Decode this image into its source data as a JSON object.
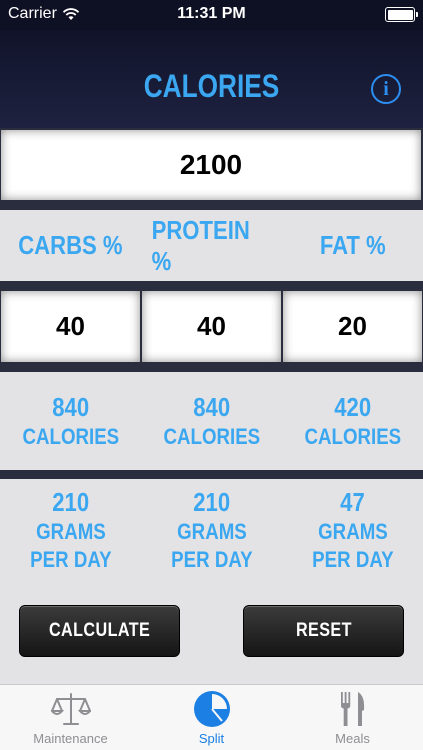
{
  "status_bar": {
    "carrier": "Carrier",
    "time": "11:31 PM"
  },
  "header": {
    "title": "CALORIES",
    "info_label": "i"
  },
  "calories_input": {
    "value": "2100"
  },
  "macro_headers": [
    "CARBS %",
    "PROTEIN %",
    "FAT %"
  ],
  "percent_inputs": [
    "40",
    "40",
    "20"
  ],
  "calories_split": [
    {
      "value": "840",
      "unit": "CALORIES"
    },
    {
      "value": "840",
      "unit": "CALORIES"
    },
    {
      "value": "420",
      "unit": "CALORIES"
    }
  ],
  "grams_split": [
    {
      "value": "210",
      "unit1": "GRAMS",
      "unit2": "PER DAY"
    },
    {
      "value": "210",
      "unit1": "GRAMS",
      "unit2": "PER DAY"
    },
    {
      "value": "47",
      "unit1": "GRAMS",
      "unit2": "PER DAY"
    }
  ],
  "buttons": {
    "calculate": "CALCULATE",
    "reset": "RESET"
  },
  "tabs": [
    {
      "label": "Maintenance",
      "icon": "scale-icon"
    },
    {
      "label": "Split",
      "icon": "pie-chart-icon",
      "active": true
    },
    {
      "label": "Meals",
      "icon": "fork-knife-icon"
    }
  ],
  "colors": {
    "accent": "#3aa7f0",
    "tab_active": "#1b7fe3",
    "band": "#e3e3e6",
    "nav": "#101329"
  }
}
